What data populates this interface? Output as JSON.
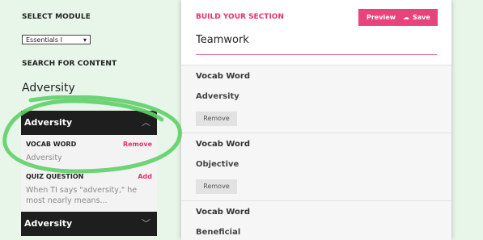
{
  "module": {
    "label": "SELECT MODULE",
    "selected": "Essentials I"
  },
  "search": {
    "label": "SEARCH FOR CONTENT",
    "value": "Adversity"
  },
  "results": [
    {
      "title": "Adversity",
      "items": [
        {
          "heading": "VOCAB WORD",
          "action": "Remove",
          "text": "Adversity"
        },
        {
          "heading": "QUIZ QUESTION",
          "action": "Add",
          "text": "When TI says \"adversity,\" he most nearly means..."
        }
      ]
    },
    {
      "title": "Adversity"
    }
  ],
  "builder": {
    "title": "BUILD YOUR SECTION",
    "preview_label": "Preview",
    "save_label": "Save",
    "section_name": "Teamwork",
    "cards": [
      {
        "type": "Vocab Word",
        "word": "Adversity",
        "remove": "Remove"
      },
      {
        "type": "Vocab Word",
        "word": "Objective",
        "remove": "Remove"
      },
      {
        "type": "Vocab Word",
        "word": "Beneficial"
      }
    ]
  },
  "colors": {
    "accent": "#e8437a",
    "highlight": "#5fd068"
  }
}
